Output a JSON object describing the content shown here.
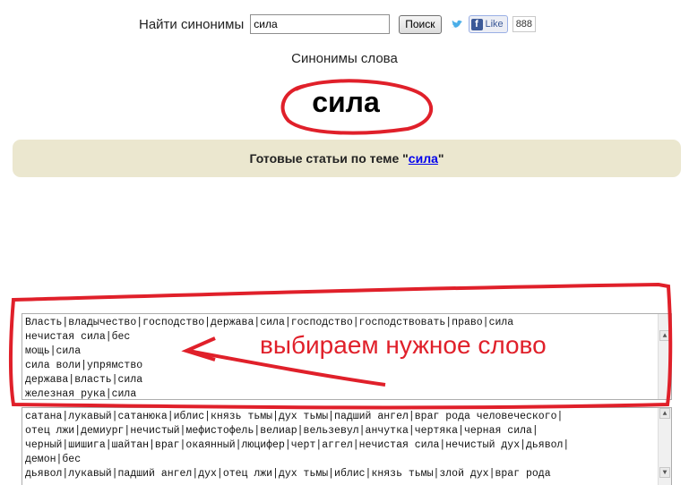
{
  "search": {
    "label": "Найти синонимы",
    "value": "сила",
    "button_label": "Поиск",
    "like_label": "Like",
    "like_count": "888"
  },
  "header": {
    "subtitle": "Синонимы слова",
    "word": "сила"
  },
  "articles": {
    "prefix": "Готовые статьи по теме \"",
    "link": "сила",
    "suffix": "\""
  },
  "textarea1": {
    "lines": [
      "Власть|владычество|господство|держава|сила|господство|господствовать|право|сила",
      "нечистая сила|бес",
      "мощь|сила",
      "сила воли|упрямство",
      "держава|власть|сила",
      "железная рука|сила"
    ]
  },
  "textarea2": {
    "lines": [
      "сатана|лукавый|сатанюка|иблис|князь тьмы|дух тьмы|падший ангел|враг рода человеческого|",
      "отец лжи|демиург|нечистый|мефистофель|велиар|вельзевул|анчутка|чертяка|черная сила|",
      "черный|шишига|шайтан|враг|окаянный|люцифер|черт|аггел|нечистая сила|нечистый дух|дьявол|",
      "демон|бес",
      "дьявол|лукавый|падший ангел|дух|отец лжи|дух тьмы|иблис|князь тьмы|злой дух|враг рода"
    ]
  },
  "annotation": {
    "text": "выбираем нужное слово"
  },
  "colors": {
    "annotation_red": "#e0202a",
    "articles_bg": "#ebe7cf",
    "link": "#0000ee"
  }
}
